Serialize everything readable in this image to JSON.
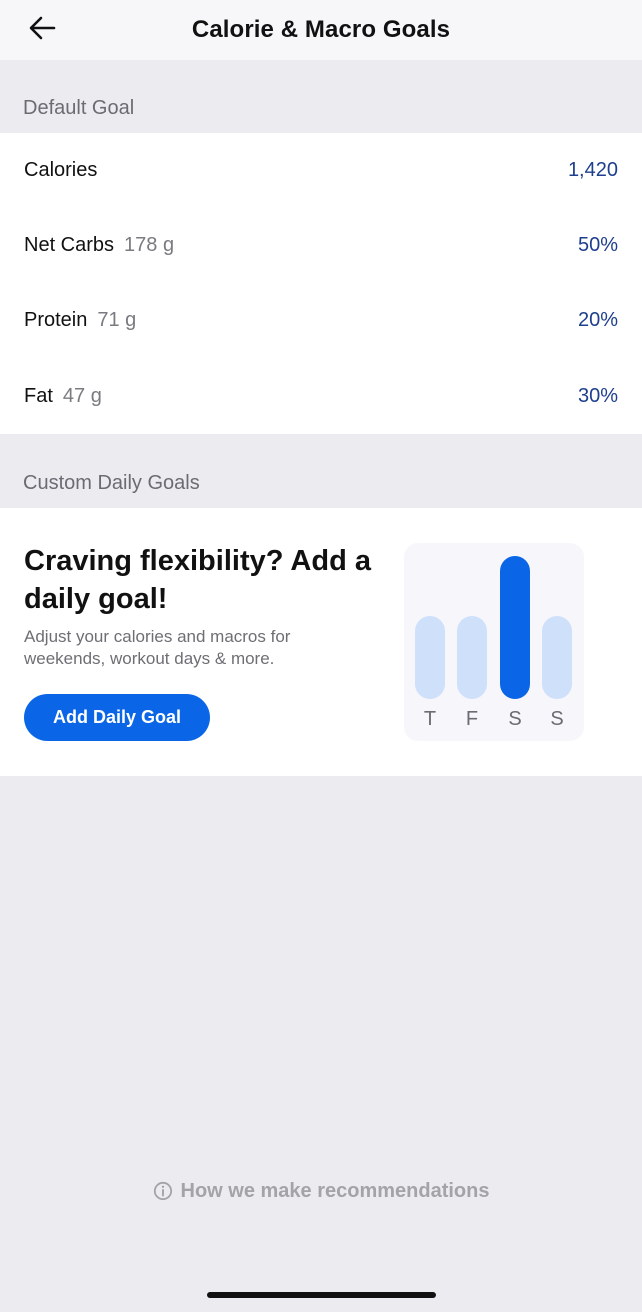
{
  "header": {
    "title": "Calorie & Macro Goals",
    "back_icon": "arrow-left-icon"
  },
  "default_goal": {
    "label": "Default Goal",
    "rows": [
      {
        "name": "Calories",
        "sub": "",
        "value": "1,420"
      },
      {
        "name": "Net Carbs",
        "sub": "178 g",
        "value": "50%"
      },
      {
        "name": "Protein",
        "sub": "71 g",
        "value": "20%"
      },
      {
        "name": "Fat",
        "sub": "47 g",
        "value": "30%"
      }
    ]
  },
  "custom_goals": {
    "label": "Custom Daily Goals",
    "promo": {
      "title": "Craving flexibility? Add a daily goal!",
      "body": "Adjust your calories and macros for weekends, workout days & more.",
      "button": "Add Daily Goal"
    },
    "illustration": {
      "days": [
        "T",
        "F",
        "S",
        "S"
      ],
      "levels": [
        0.58,
        0.58,
        1.0,
        0.58
      ],
      "highlighted_index": 2,
      "accent_color": "#0a66e6",
      "muted_color": "#cfe0fb"
    }
  },
  "footer": {
    "info_icon": "info-circle-icon",
    "link": "How we make recommendations"
  },
  "colors": {
    "background": "#ececf0",
    "accent": "#0a66e6",
    "value_text": "#1e3f8e"
  }
}
